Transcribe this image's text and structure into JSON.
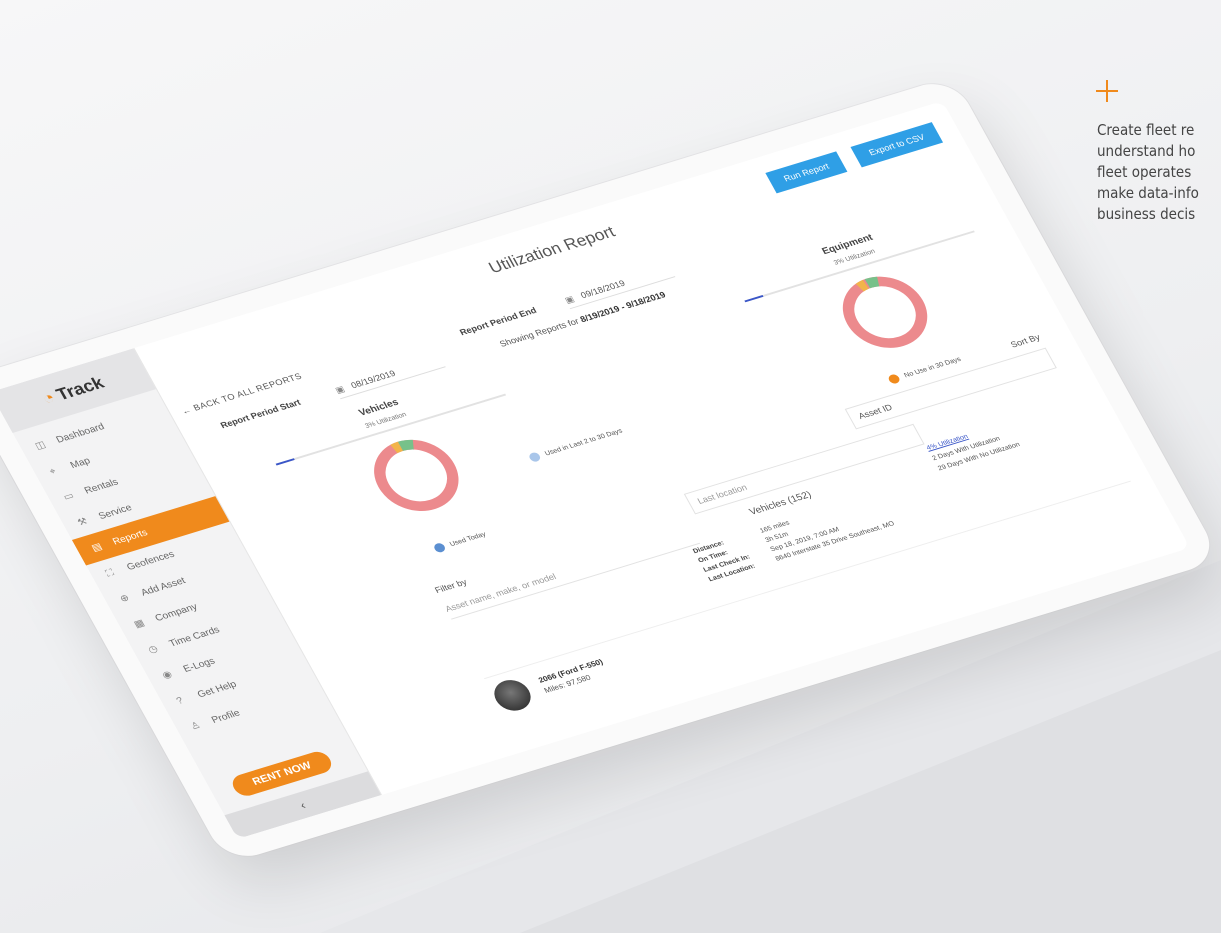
{
  "caption": {
    "lines": [
      "Create fleet re",
      "understand ho",
      "fleet operates",
      "make data-info",
      "business decis"
    ]
  },
  "sidebar": {
    "logo": "Track",
    "items": [
      {
        "label": "Dashboard",
        "icon": "dashboard-icon",
        "active": false
      },
      {
        "label": "Map",
        "icon": "map-icon",
        "active": false
      },
      {
        "label": "Rentals",
        "icon": "truck-icon",
        "active": false
      },
      {
        "label": "Service",
        "icon": "wrench-icon",
        "active": false
      },
      {
        "label": "Reports",
        "icon": "report-icon",
        "active": true
      },
      {
        "label": "Geofences",
        "icon": "geofence-icon",
        "active": false
      },
      {
        "label": "Add Asset",
        "icon": "add-icon",
        "active": false
      },
      {
        "label": "Company",
        "icon": "company-icon",
        "active": false
      },
      {
        "label": "Time Cards",
        "icon": "timecard-icon",
        "active": false
      },
      {
        "label": "E-Logs",
        "icon": "elog-icon",
        "active": false
      },
      {
        "label": "Get Help",
        "icon": "help-icon",
        "active": false
      },
      {
        "label": "Profile",
        "icon": "profile-icon",
        "active": false
      }
    ],
    "rent_now": "RENT NOW",
    "collapse": "‹"
  },
  "header": {
    "title": "Utilization Report",
    "run_report": "Run Report",
    "export_csv": "Export to CSV",
    "back": "← BACK TO ALL REPORTS"
  },
  "period": {
    "start_label": "Report Period Start",
    "start_value": "08/19/2019",
    "end_label": "Report Period End",
    "end_value": "09/18/2019",
    "showing_prefix": "Showing Reports for",
    "showing_range": "8/19/2019 - 9/18/2019"
  },
  "vehicles_panel": {
    "title": "Vehicles",
    "pct": "3% Utilization",
    "bar_fraction": 0.03,
    "legend_used_today": "Used Today",
    "legend_used_last": "Used in Last 2 to 30 Days"
  },
  "equipment_panel": {
    "title": "Equipment",
    "pct": "3% Utilization",
    "bar_fraction": 0.03,
    "legend_no_use": "No Use in 30 Days"
  },
  "colors": {
    "accent": "#f08a1c",
    "button": "#2f9fe6",
    "donut_main": "#ec8a8d",
    "donut_green": "#77c18a",
    "donut_yellow": "#f2b44a",
    "used_today": "#5b8fd1",
    "used_last": "#a9c6ea",
    "no_use": "#f08a1c"
  },
  "filters": {
    "sort_label": "Sort By",
    "sort_value": "Asset ID",
    "filter_label": "Filter by",
    "filter_placeholder": "Asset name, make, or model",
    "location_placeholder": "Last location"
  },
  "vehicles": {
    "heading": "Vehicles (152)",
    "util_line1": "4% Utilization",
    "util_line2": "2 Days With Utilization",
    "util_line3": "29 Days With No Utilization",
    "details": [
      {
        "key": "Distance:",
        "value": "165 miles"
      },
      {
        "key": "On Time:",
        "value": "3h 51m"
      },
      {
        "key": "Last Check In:",
        "value": "Sep 18, 2019, 7:00 AM"
      },
      {
        "key": "Last Location:",
        "value": "8640 Interstate 35 Drive Southeast, MO"
      }
    ],
    "row_name": "2066 (Ford F-550)",
    "row_miles": "Miles: 97,580"
  }
}
